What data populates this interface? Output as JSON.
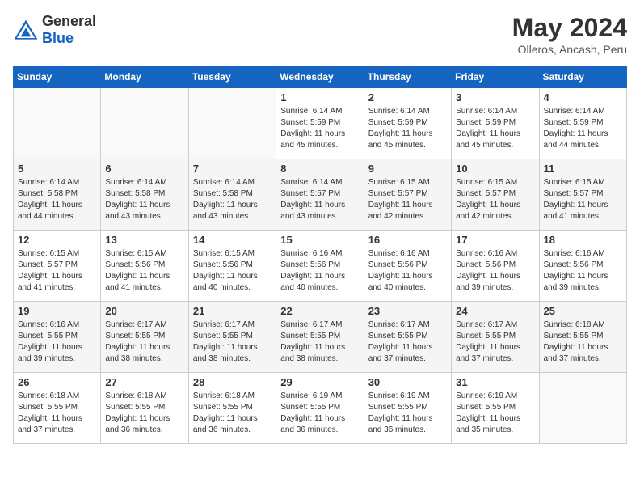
{
  "header": {
    "logo_general": "General",
    "logo_blue": "Blue",
    "title": "May 2024",
    "location": "Olleros, Ancash, Peru"
  },
  "days_of_week": [
    "Sunday",
    "Monday",
    "Tuesday",
    "Wednesday",
    "Thursday",
    "Friday",
    "Saturday"
  ],
  "weeks": [
    {
      "cells": [
        {
          "day": "",
          "info": ""
        },
        {
          "day": "",
          "info": ""
        },
        {
          "day": "",
          "info": ""
        },
        {
          "day": "1",
          "info": "Sunrise: 6:14 AM\nSunset: 5:59 PM\nDaylight: 11 hours\nand 45 minutes."
        },
        {
          "day": "2",
          "info": "Sunrise: 6:14 AM\nSunset: 5:59 PM\nDaylight: 11 hours\nand 45 minutes."
        },
        {
          "day": "3",
          "info": "Sunrise: 6:14 AM\nSunset: 5:59 PM\nDaylight: 11 hours\nand 45 minutes."
        },
        {
          "day": "4",
          "info": "Sunrise: 6:14 AM\nSunset: 5:59 PM\nDaylight: 11 hours\nand 44 minutes."
        }
      ]
    },
    {
      "cells": [
        {
          "day": "5",
          "info": "Sunrise: 6:14 AM\nSunset: 5:58 PM\nDaylight: 11 hours\nand 44 minutes."
        },
        {
          "day": "6",
          "info": "Sunrise: 6:14 AM\nSunset: 5:58 PM\nDaylight: 11 hours\nand 43 minutes."
        },
        {
          "day": "7",
          "info": "Sunrise: 6:14 AM\nSunset: 5:58 PM\nDaylight: 11 hours\nand 43 minutes."
        },
        {
          "day": "8",
          "info": "Sunrise: 6:14 AM\nSunset: 5:57 PM\nDaylight: 11 hours\nand 43 minutes."
        },
        {
          "day": "9",
          "info": "Sunrise: 6:15 AM\nSunset: 5:57 PM\nDaylight: 11 hours\nand 42 minutes."
        },
        {
          "day": "10",
          "info": "Sunrise: 6:15 AM\nSunset: 5:57 PM\nDaylight: 11 hours\nand 42 minutes."
        },
        {
          "day": "11",
          "info": "Sunrise: 6:15 AM\nSunset: 5:57 PM\nDaylight: 11 hours\nand 41 minutes."
        }
      ]
    },
    {
      "cells": [
        {
          "day": "12",
          "info": "Sunrise: 6:15 AM\nSunset: 5:57 PM\nDaylight: 11 hours\nand 41 minutes."
        },
        {
          "day": "13",
          "info": "Sunrise: 6:15 AM\nSunset: 5:56 PM\nDaylight: 11 hours\nand 41 minutes."
        },
        {
          "day": "14",
          "info": "Sunrise: 6:15 AM\nSunset: 5:56 PM\nDaylight: 11 hours\nand 40 minutes."
        },
        {
          "day": "15",
          "info": "Sunrise: 6:16 AM\nSunset: 5:56 PM\nDaylight: 11 hours\nand 40 minutes."
        },
        {
          "day": "16",
          "info": "Sunrise: 6:16 AM\nSunset: 5:56 PM\nDaylight: 11 hours\nand 40 minutes."
        },
        {
          "day": "17",
          "info": "Sunrise: 6:16 AM\nSunset: 5:56 PM\nDaylight: 11 hours\nand 39 minutes."
        },
        {
          "day": "18",
          "info": "Sunrise: 6:16 AM\nSunset: 5:56 PM\nDaylight: 11 hours\nand 39 minutes."
        }
      ]
    },
    {
      "cells": [
        {
          "day": "19",
          "info": "Sunrise: 6:16 AM\nSunset: 5:55 PM\nDaylight: 11 hours\nand 39 minutes."
        },
        {
          "day": "20",
          "info": "Sunrise: 6:17 AM\nSunset: 5:55 PM\nDaylight: 11 hours\nand 38 minutes."
        },
        {
          "day": "21",
          "info": "Sunrise: 6:17 AM\nSunset: 5:55 PM\nDaylight: 11 hours\nand 38 minutes."
        },
        {
          "day": "22",
          "info": "Sunrise: 6:17 AM\nSunset: 5:55 PM\nDaylight: 11 hours\nand 38 minutes."
        },
        {
          "day": "23",
          "info": "Sunrise: 6:17 AM\nSunset: 5:55 PM\nDaylight: 11 hours\nand 37 minutes."
        },
        {
          "day": "24",
          "info": "Sunrise: 6:17 AM\nSunset: 5:55 PM\nDaylight: 11 hours\nand 37 minutes."
        },
        {
          "day": "25",
          "info": "Sunrise: 6:18 AM\nSunset: 5:55 PM\nDaylight: 11 hours\nand 37 minutes."
        }
      ]
    },
    {
      "cells": [
        {
          "day": "26",
          "info": "Sunrise: 6:18 AM\nSunset: 5:55 PM\nDaylight: 11 hours\nand 37 minutes."
        },
        {
          "day": "27",
          "info": "Sunrise: 6:18 AM\nSunset: 5:55 PM\nDaylight: 11 hours\nand 36 minutes."
        },
        {
          "day": "28",
          "info": "Sunrise: 6:18 AM\nSunset: 5:55 PM\nDaylight: 11 hours\nand 36 minutes."
        },
        {
          "day": "29",
          "info": "Sunrise: 6:19 AM\nSunset: 5:55 PM\nDaylight: 11 hours\nand 36 minutes."
        },
        {
          "day": "30",
          "info": "Sunrise: 6:19 AM\nSunset: 5:55 PM\nDaylight: 11 hours\nand 36 minutes."
        },
        {
          "day": "31",
          "info": "Sunrise: 6:19 AM\nSunset: 5:55 PM\nDaylight: 11 hours\nand 35 minutes."
        },
        {
          "day": "",
          "info": ""
        }
      ]
    }
  ]
}
